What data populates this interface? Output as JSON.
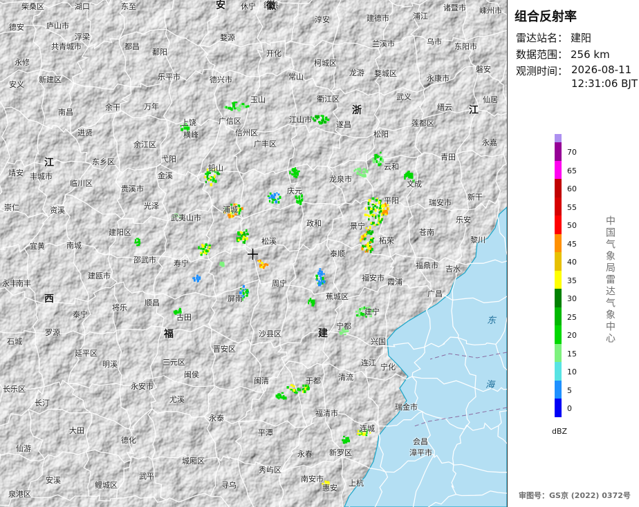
{
  "panel": {
    "title": "组合反射率",
    "station_label": "雷达站名：",
    "station_value": "建阳",
    "range_label": "数据范围：",
    "range_value": "256 km",
    "time_label": "观测时间：",
    "time_date": "2026-08-11",
    "time_clock": "12:31:06 BJT",
    "unit": "dBZ",
    "vertical_note": "中国气象局雷达气象中心",
    "approval": "审图号：GS京 (2022) 0372号"
  },
  "legend": {
    "ticks": [
      "70",
      "65",
      "60",
      "55",
      "50",
      "45",
      "40",
      "35",
      "30",
      "25",
      "20",
      "15",
      "10",
      "5",
      "0"
    ],
    "colors": [
      "#ad90f0",
      "#960096",
      "#ff00f0",
      "#c00000",
      "#d60000",
      "#ff0000",
      "#ff9000",
      "#e7c000",
      "#ffff00",
      "#008000",
      "#00b800",
      "#00d800",
      "#7ef27e",
      "#58e3e3",
      "#1e90ff",
      "#0000f6"
    ]
  },
  "colors": {
    "sea": "#b4dff3",
    "coast": "#1aa6c9",
    "land": "#ececec",
    "boundary": "#ffffff"
  },
  "map": {
    "radar_marker_icon": "crosshair-icon",
    "provinces": [
      "安",
      "徽",
      "浙",
      "江",
      "江",
      "西",
      "福",
      "建"
    ],
    "seas": [
      "东",
      "海"
    ],
    "cities": [
      "柴桑区",
      "湖口",
      "东至",
      "休宁",
      "歙县",
      "淳安",
      "建德市",
      "浦江",
      "诸暨市",
      "嵊州市",
      "德安",
      "庐山市",
      "浮梁",
      "都昌",
      "鄱阳",
      "婺源",
      "兰溪市",
      "乌市",
      "东阳市",
      "永修",
      "共青城市",
      "乐平市",
      "开化",
      "常山",
      "柯城区",
      "龙游",
      "婺城区",
      "永康市",
      "磐安",
      "安义",
      "新建区",
      "德兴市",
      "衢江区",
      "武义",
      "缙云",
      "仙居",
      "南昌",
      "余干",
      "万年",
      "玉山",
      "遂昌",
      "莲都区",
      "进贤",
      "上饶",
      "广信区",
      "信州区",
      "江山市",
      "松阳",
      "横峰",
      "广丰区",
      "余江区",
      "东乡区",
      "弋阳",
      "铅山",
      "云和",
      "青田",
      "永嘉",
      "靖安",
      "丰城市",
      "临川区",
      "贵溪市",
      "金溪",
      "龙泉市",
      "文成",
      "瑞安市",
      "新干",
      "崇仁",
      "资溪",
      "光泽",
      "武夷山市",
      "浦城",
      "庆元",
      "景宁",
      "平阳",
      "乐安",
      "宜黄",
      "南城",
      "建阳区",
      "松溪",
      "政和",
      "泰顺",
      "苍南",
      "黎川",
      "邵武市",
      "寿宁",
      "柘荣",
      "福鼎市",
      "吉水",
      "永丰",
      "南丰",
      "建瓯市",
      "周宁",
      "福安市",
      "霞浦",
      "广昌",
      "泰宁",
      "顺昌",
      "屏南",
      "蕉城区",
      "建宁",
      "将乐",
      "古田",
      "宁都",
      "罗源",
      "兴国",
      "石城",
      "延平区",
      "沙县区",
      "晋安区",
      "连江",
      "宁化",
      "明溪",
      "三元区",
      "闽侯",
      "清流",
      "永安市",
      "尤溪",
      "闽清",
      "于都",
      "长乐区",
      "瑞金市",
      "长汀",
      "大田",
      "永泰",
      "福清市",
      "连城",
      "德化",
      "平潭",
      "会昌",
      "漳平市",
      "仙游",
      "城厢区",
      "永春",
      "新罗区",
      "秀屿区",
      "武平",
      "上杭",
      "安溪",
      "鲤城区",
      "寻乌",
      "南安市",
      "惠安",
      "泉港区"
    ]
  }
}
